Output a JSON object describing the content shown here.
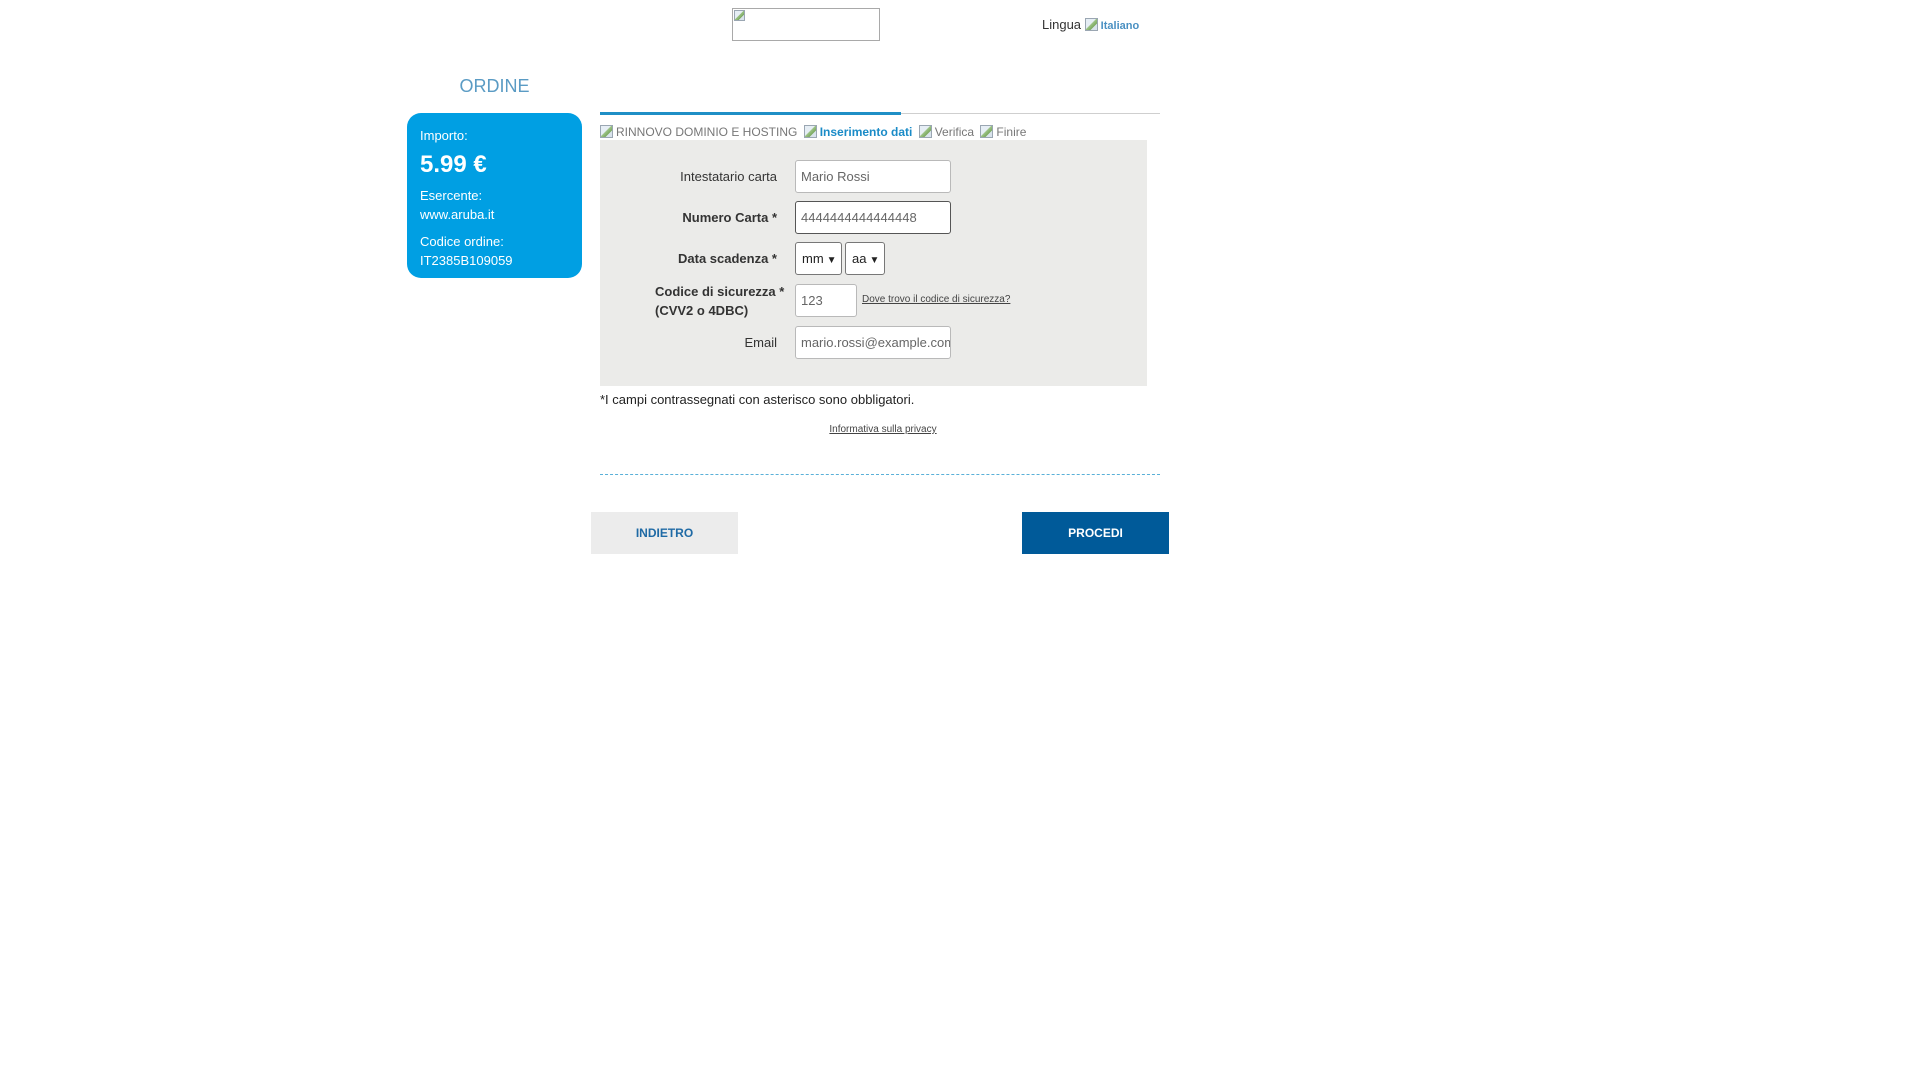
{
  "header": {
    "lang_label": "Lingua",
    "lang_value": "Italiano"
  },
  "sidebar": {
    "title": "ORDINE",
    "amount_label": "Importo:",
    "amount": "5.99 €",
    "merchant_label": "Esercente:",
    "merchant": "www.aruba.it",
    "order_label": "Codice ordine:",
    "order_code": "IT2385B109059"
  },
  "steps": [
    {
      "label": "RINNOVO DOMINIO E HOSTING",
      "active": false
    },
    {
      "label": "Inserimento dati",
      "active": true
    },
    {
      "label": "Verifica",
      "active": false
    },
    {
      "label": "Finire",
      "active": false
    }
  ],
  "form": {
    "holder_label": "Intestatario carta",
    "holder_placeholder": "Mario Rossi",
    "card_label": "Numero Carta *",
    "card_placeholder": "4444444444444448",
    "expiry_label": "Data scadenza *",
    "month_value": "mm",
    "year_value": "aa",
    "cvv_label_1": "Codice di sicurezza *",
    "cvv_label_2": "(CVV2 o 4DBC)",
    "cvv_placeholder": "123",
    "cvv_help": "Dove trovo il codice di sicurezza?",
    "email_label": "Email",
    "email_placeholder": "mario.rossi@example.com"
  },
  "required_note": "*I campi contrassegnati con asterisco sono obbligatori.",
  "privacy_link": "Informativa sulla privacy",
  "buttons": {
    "back": "INDIETRO",
    "next": "PROCEDI"
  },
  "colors": {
    "summary_bg": "#009fe3",
    "primary_button": "#005a99",
    "active_step": "#1a8bc7",
    "form_bg": "#ebebe9"
  }
}
